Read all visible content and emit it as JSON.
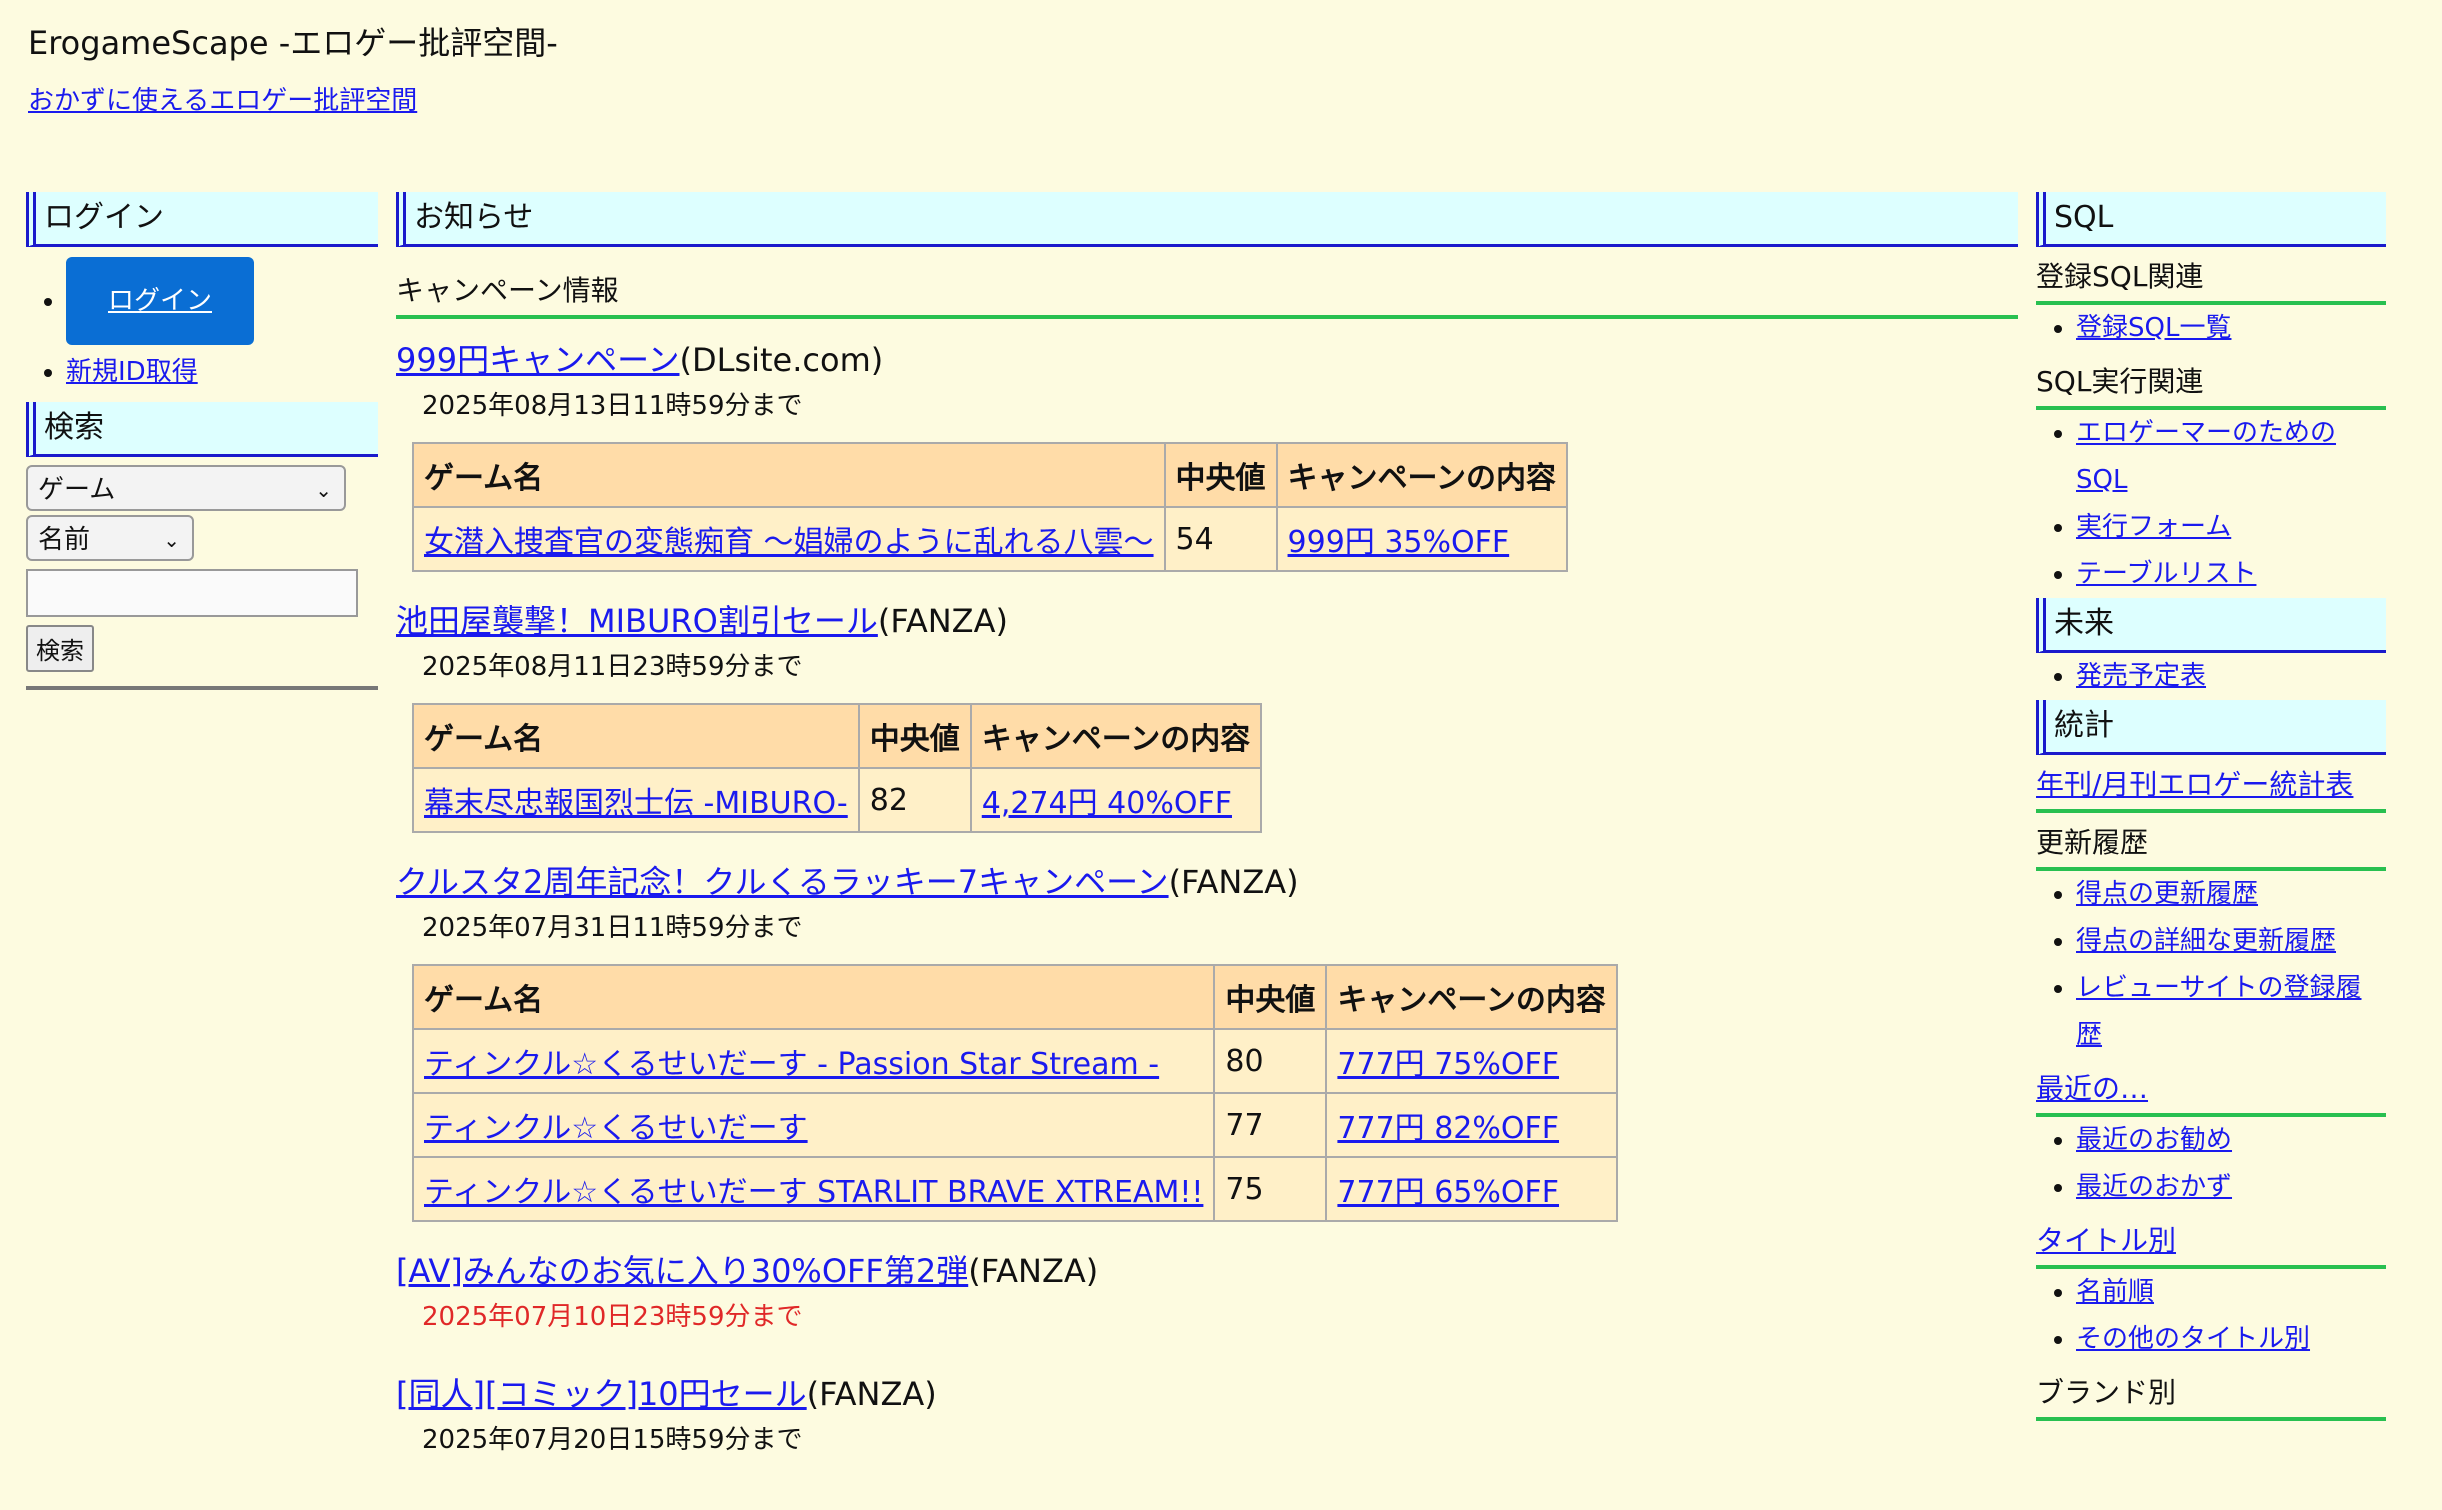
{
  "site": {
    "title": "ErogameScape -エロゲー批評空間-",
    "subtitle_link": "おかずに使えるエロゲー批評空間"
  },
  "left": {
    "login_header": "ログイン",
    "login_button": "ログイン",
    "new_id_link": "新規ID取得",
    "search_header": "検索",
    "search_type_value": "ゲーム",
    "search_field_value": "名前",
    "search_input_value": "",
    "search_button": "検索"
  },
  "main": {
    "header": "お知らせ",
    "section_title": "キャンペーン情報",
    "table_headers": [
      "ゲーム名",
      "中央値",
      "キャンペーンの内容"
    ],
    "campaigns": [
      {
        "title": "999円キャンペーン",
        "store": "(DLsite.com)",
        "deadline": "2025年08月13日11時59分まで",
        "rows": [
          {
            "game": "女潜入捜査官の変態痴育 ～娼婦のように乱れる八雲～",
            "median": "54",
            "content": "999円 35%OFF"
          }
        ]
      },
      {
        "title": "池田屋襲撃！MIBURO割引セール",
        "store": "(FANZA)",
        "deadline": "2025年08月11日23時59分まで",
        "rows": [
          {
            "game": "幕末尽忠報国烈士伝 -MIBURO-",
            "median": "82",
            "content": "4,274円 40%OFF"
          }
        ]
      },
      {
        "title": "クルスタ2周年記念！クルくるラッキー7キャンペーン",
        "store": "(FANZA)",
        "deadline": "2025年07月31日11時59分まで",
        "rows": [
          {
            "game": "ティンクル☆くるせいだーす - Passion Star Stream -",
            "median": "80",
            "content": "777円 75%OFF"
          },
          {
            "game": "ティンクル☆くるせいだーす",
            "median": "77",
            "content": "777円 82%OFF"
          },
          {
            "game": "ティンクル☆くるせいだーす STARLIT BRAVE XTREAM!!",
            "median": "75",
            "content": "777円 65%OFF"
          }
        ]
      },
      {
        "title": "[AV]みんなのお気に入り30%OFF第2弾",
        "store": "(FANZA)",
        "deadline": "2025年07月10日23時59分まで",
        "expired": true,
        "rows": []
      },
      {
        "title": "[同人][コミック]10円セール",
        "store": "(FANZA)",
        "deadline": "2025年07月20日15時59分まで",
        "rows": []
      }
    ]
  },
  "right": {
    "sql_header": "SQL",
    "reg_sql_title": "登録SQL関連",
    "reg_sql_items": [
      "登録SQL一覧"
    ],
    "exec_sql_title": "SQL実行関連",
    "exec_sql_items": [
      "エロゲーマーのための SQL",
      "実行フォーム",
      "テーブルリスト"
    ],
    "future_header": "未来",
    "future_items": [
      "発売予定表"
    ],
    "stats_header": "統計",
    "stats_link": "年刊/月刊エロゲー統計表",
    "history_title": "更新履歴",
    "history_items": [
      "得点の更新履歴",
      "得点の詳細な更新履歴",
      "レビューサイトの登録履歴"
    ],
    "recent_link": "最近の…",
    "recent_items": [
      "最近のお勧め",
      "最近のおかず"
    ],
    "title_link": "タイトル別",
    "title_items": [
      "名前順",
      "その他のタイトル別"
    ],
    "brand_title": "ブランド別"
  }
}
